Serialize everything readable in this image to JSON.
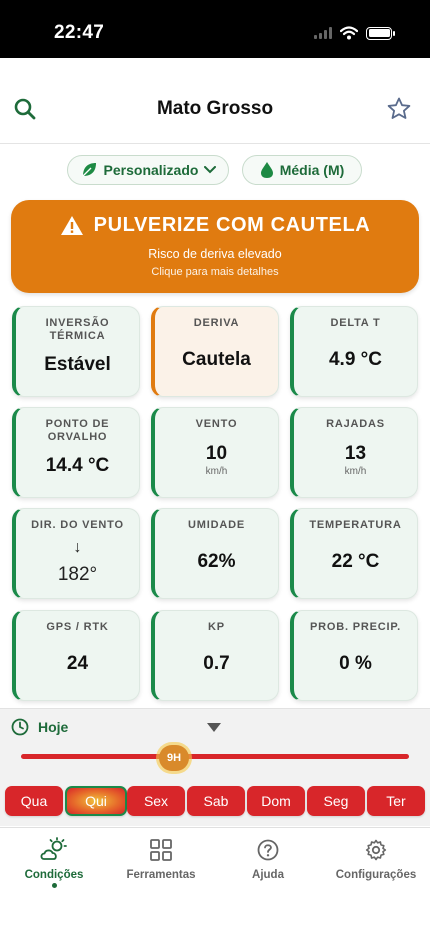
{
  "status_bar": {
    "time": "22:47"
  },
  "header": {
    "title": "Mato Grosso"
  },
  "pills": {
    "profile": "Personalizado",
    "droplet": "Média (M)"
  },
  "alert": {
    "title": "PULVERIZE COM CAUTELA",
    "subtitle": "Risco de deriva elevado",
    "hint": "Clique para mais detalhes",
    "color": "#e07b10"
  },
  "cards": [
    {
      "label": "INVERSÃO TÉRMICA",
      "value": "Estável"
    },
    {
      "label": "DERIVA",
      "value": "Cautela",
      "status": "warning"
    },
    {
      "label": "DELTA T",
      "value": "4.9 °C"
    },
    {
      "label": "PONTO DE ORVALHO",
      "value": "14.4 °C"
    },
    {
      "label": "VENTO",
      "value": "10",
      "unit": "km/h"
    },
    {
      "label": "RAJADAS",
      "value": "13",
      "unit": "km/h"
    },
    {
      "label": "DIR. DO VENTO",
      "arrow": "↓",
      "value": "182°"
    },
    {
      "label": "UMIDADE",
      "value": "62%"
    },
    {
      "label": "TEMPERATURA",
      "value": "22 °C"
    },
    {
      "label": "GPS / RTK",
      "value": "24"
    },
    {
      "label": "KP",
      "value": "0.7"
    },
    {
      "label": "PROB. PRECIP.",
      "value": "0 %"
    }
  ],
  "timeline": {
    "today_label": "Hoje",
    "hour_label": "9H",
    "days": [
      "Qua",
      "Qui",
      "Sex",
      "Sab",
      "Dom",
      "Seg",
      "Ter"
    ],
    "selected_day": "Qui"
  },
  "tabbar": [
    {
      "label": "Condições",
      "icon": "weather-icon",
      "active": true
    },
    {
      "label": "Ferramentas",
      "icon": "grid-icon"
    },
    {
      "label": "Ajuda",
      "icon": "help-icon"
    },
    {
      "label": "Configurações",
      "icon": "settings-icon"
    }
  ],
  "colors": {
    "brand_green": "#1e6b3a",
    "accent_green": "#1b8a4a",
    "danger_red": "#d8262a",
    "warning_orange": "#e07b10"
  }
}
